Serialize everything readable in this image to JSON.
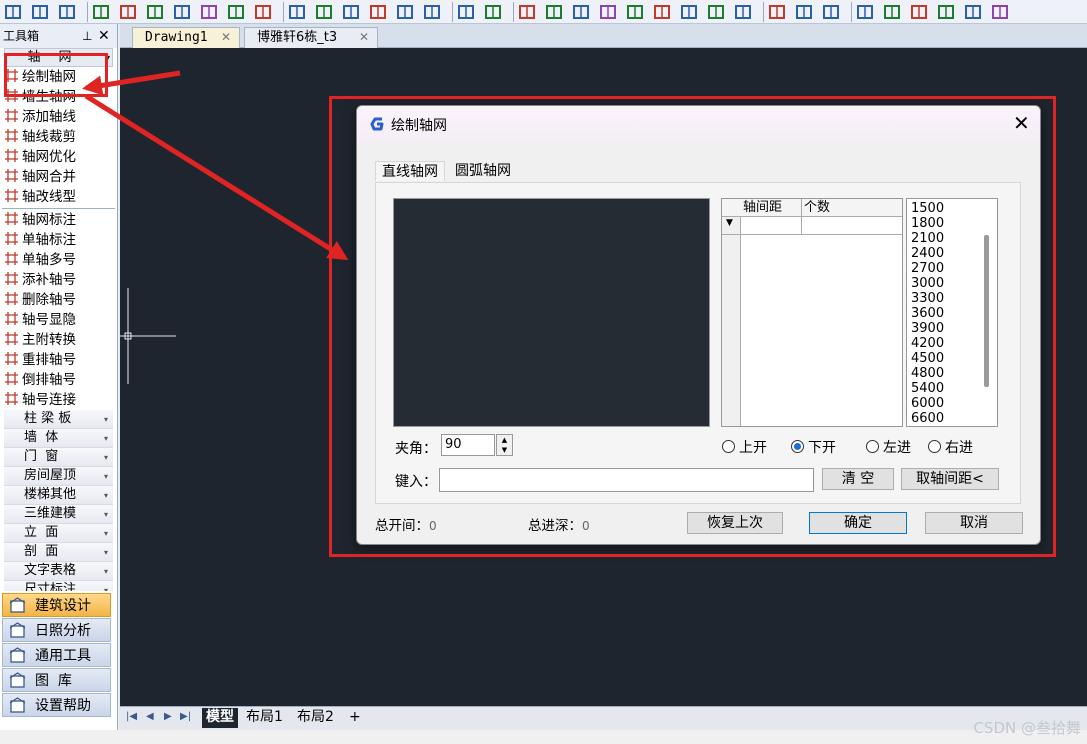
{
  "toolbox": {
    "title": "工具箱",
    "pin": "ᵖ",
    "close": "✕",
    "section_header": "轴网",
    "tools_group1": [
      "绘制轴网",
      "墙生轴网",
      "添加轴线",
      "轴线裁剪",
      "轴网优化",
      "轴网合并",
      "轴改线型"
    ],
    "tools_group2": [
      "轴网标注",
      "单轴标注",
      "单轴多号",
      "添补轴号",
      "删除轴号",
      "轴号显隐",
      "主附转换",
      "重排轴号",
      "倒排轴号",
      "轴号连接"
    ],
    "categories": [
      "柱 梁 板",
      "墙  体",
      "门  窗",
      "房间屋顶",
      "楼梯其他",
      "三维建模",
      "立  面",
      "剖  面",
      "文字表格",
      "尺寸标注"
    ],
    "big_buttons": [
      {
        "label": "建筑设计",
        "icon": "house-icon"
      },
      {
        "label": "日照分析",
        "icon": "sun-analysis-icon"
      },
      {
        "label": "通用工具",
        "icon": "tools-icon"
      },
      {
        "label": "图  库",
        "icon": "library-icon"
      },
      {
        "label": "设置帮助",
        "icon": "help-icon"
      }
    ]
  },
  "doc_tabs": [
    {
      "label": "Drawing1"
    },
    {
      "label": "博雅轩6栋_t3"
    }
  ],
  "layout_tabs": [
    "模型",
    "布局1",
    "布局2",
    "+"
  ],
  "dialog": {
    "title": "绘制轴网",
    "close": "✕",
    "tabs": [
      "直线轴网",
      "圆弧轴网"
    ],
    "grid_headers": [
      "轴间距",
      "个数"
    ],
    "grid_dropdown": "▼",
    "values": [
      "1500",
      "1800",
      "2100",
      "2400",
      "2700",
      "3000",
      "3300",
      "3600",
      "3900",
      "4200",
      "4500",
      "4800",
      "5400",
      "6000",
      "6600"
    ],
    "angle_label": "夹角：",
    "angle_value": "90",
    "radios": [
      {
        "label": "上开",
        "checked": false
      },
      {
        "label": "下开",
        "checked": true
      },
      {
        "label": "左进",
        "checked": false
      },
      {
        "label": "右进",
        "checked": false
      }
    ],
    "input_label": "键入：",
    "input_value": "",
    "clear_button": "清  空",
    "take_spacing_button": "取轴间距<",
    "total_bays_label": "总开间：",
    "total_bays_value": "0",
    "total_depth_label": "总进深：",
    "total_depth_value": "0",
    "restore_button": "恢复上次",
    "ok_button": "确定",
    "cancel_button": "取消"
  },
  "watermark": "CSDN @叁拾舞",
  "colors": {
    "highlight": "#e02424",
    "canvas": "#1f252e",
    "active_button": "#f3b446"
  }
}
